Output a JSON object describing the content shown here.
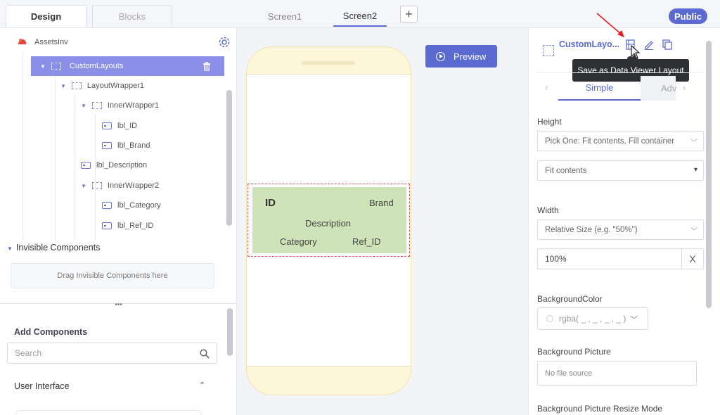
{
  "top_bar": {
    "tabs": [
      {
        "label": "Design",
        "active": true
      },
      {
        "label": "Blocks",
        "active": false
      }
    ],
    "screens": [
      {
        "label": "Screen1",
        "active": false
      },
      {
        "label": "Screen2",
        "active": true
      }
    ],
    "add_screen_label": "+",
    "public_label": "Public"
  },
  "tree": {
    "root": "AssetsInv",
    "items": [
      {
        "label": "CustomLayouts",
        "type": "wrapper",
        "selected": true
      },
      {
        "label": "LayoutWrapper1",
        "type": "wrapper"
      },
      {
        "label": "InnerWrapper1",
        "type": "wrapper"
      },
      {
        "label": "lbl_ID",
        "type": "label"
      },
      {
        "label": "lbl_Brand",
        "type": "label"
      },
      {
        "label": "lbl_Description",
        "type": "label"
      },
      {
        "label": "InnerWrapper2",
        "type": "wrapper"
      },
      {
        "label": "lbl_Category",
        "type": "label"
      },
      {
        "label": "lbl_Ref_ID",
        "type": "label"
      }
    ]
  },
  "invisible_components": {
    "title": "Invisible Components",
    "dropzone": "Drag Invisible Components here"
  },
  "add_components": {
    "title": "Add Components",
    "search_placeholder": "Search",
    "category": "User Interface"
  },
  "canvas": {
    "preview_label": "Preview",
    "layout_labels": {
      "id": "ID",
      "brand": "Brand",
      "description": "Description",
      "category": "Category",
      "ref_id": "Ref_ID"
    }
  },
  "properties": {
    "component_name": "CustomLayo...",
    "tooltip": "Save as Data Viewer Layout",
    "tabs": {
      "simple": "Simple",
      "advanced": "Adv"
    },
    "height": {
      "label": "Height",
      "pick_one": "Pick One: Fit contents, Fill container",
      "value": "Fit contents"
    },
    "width": {
      "label": "Width",
      "unit_select": "Relative Size (e.g. \"50%\")",
      "value": "100%",
      "clear": "X"
    },
    "background_color": {
      "label": "BackgroundColor",
      "value": "rgba( _ , _ , _ , _ )"
    },
    "background_picture": {
      "label": "Background Picture",
      "value": "No file source"
    },
    "background_resize": {
      "label": "Background Picture Resize Mode"
    }
  },
  "colors": {
    "accent": "#5b6ad0",
    "selected_row": "#8b8fe8",
    "layout_fill": "#cfe3b9",
    "phone_frame": "#fdf6d8",
    "annotation_arrow": "#e02020"
  }
}
